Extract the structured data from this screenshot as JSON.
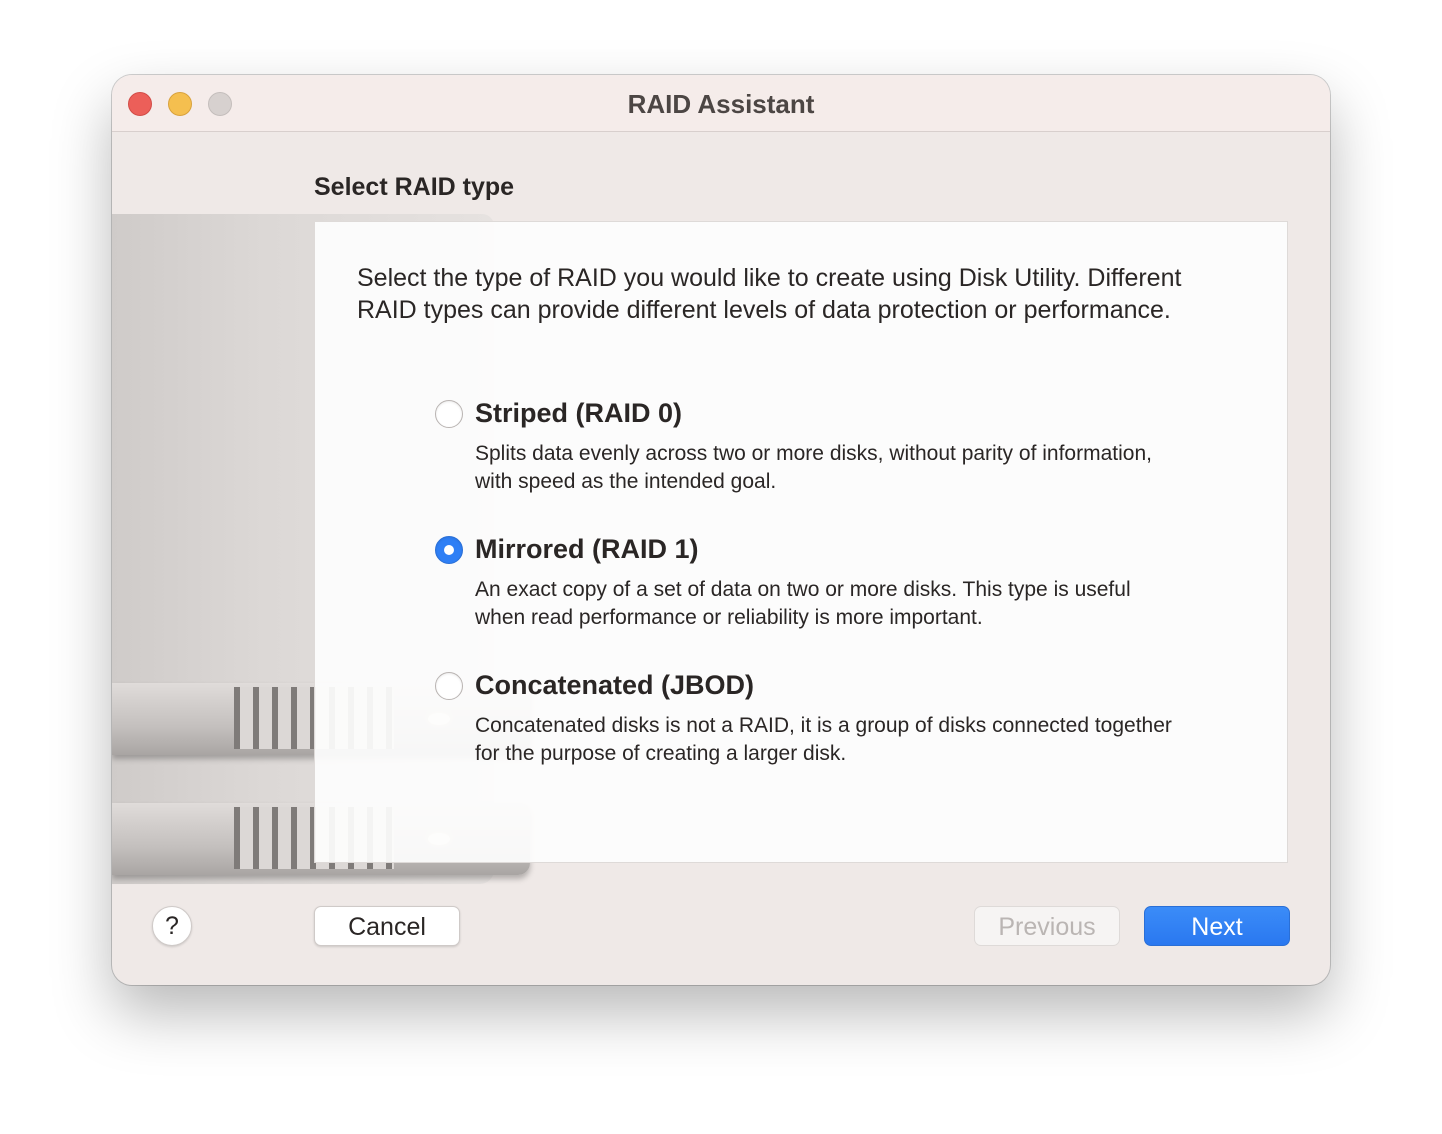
{
  "window": {
    "title": "RAID Assistant"
  },
  "section_title": "Select RAID type",
  "intro_text": "Select the type of RAID you would like to create using Disk Utility. Different RAID types can provide different levels of data protection or performance.",
  "options": [
    {
      "label": "Striped (RAID 0)",
      "description": "Splits data evenly across two or more disks, without parity of information, with speed as the intended goal.",
      "selected": false
    },
    {
      "label": "Mirrored (RAID 1)",
      "description": "An exact copy of a set of data on two or more disks. This type is useful when read performance or reliability is more important.",
      "selected": true
    },
    {
      "label": "Concatenated (JBOD)",
      "description": "Concatenated disks is not a RAID, it is a group of disks connected together for the purpose of creating a larger disk.",
      "selected": false
    }
  ],
  "buttons": {
    "help": "?",
    "cancel": "Cancel",
    "previous": "Previous",
    "next": "Next"
  },
  "colors": {
    "accent": "#2f7ff5",
    "close": "#ec5f59",
    "minimize": "#f5bf4f",
    "zoom_disabled": "#d7d1cf"
  },
  "icons": {
    "illustration": "raid-disks-illustration"
  }
}
